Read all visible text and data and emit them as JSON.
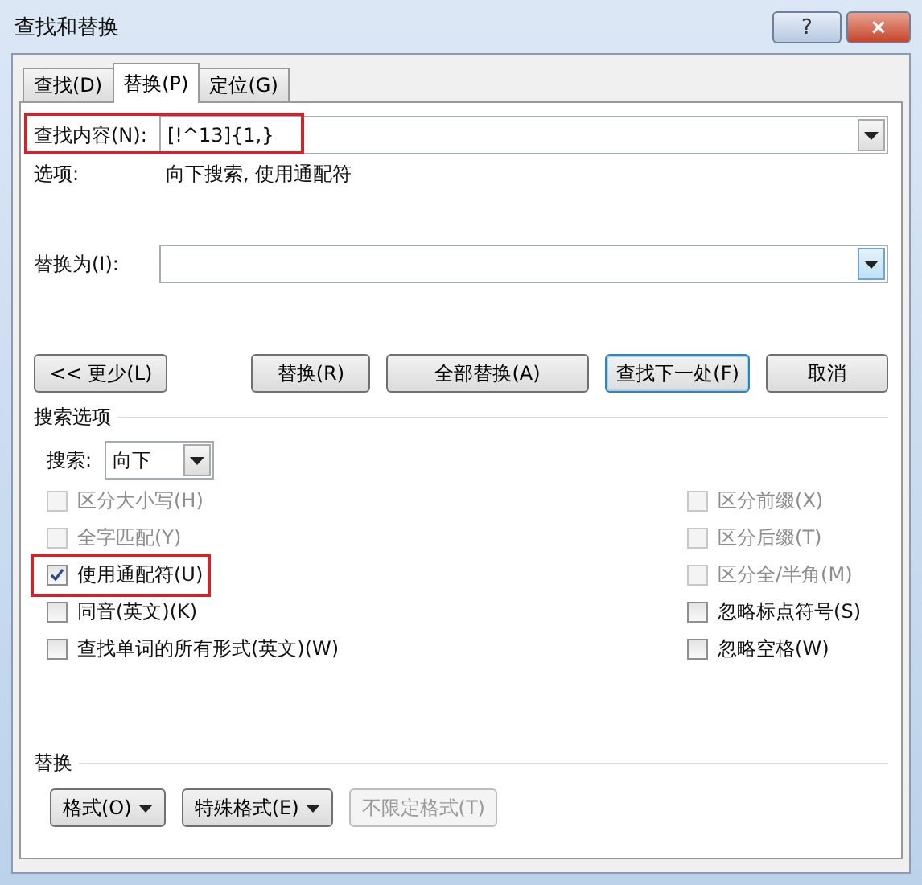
{
  "window": {
    "title": "查找和替换",
    "help": "?",
    "close": "×"
  },
  "tabs": [
    {
      "label": "查找(D)",
      "selected": false
    },
    {
      "label": "替换(P)",
      "selected": true
    },
    {
      "label": "定位(G)",
      "selected": false
    }
  ],
  "find": {
    "label": "查找内容(N):",
    "value": "[!^13]{1,}",
    "highlighted": true
  },
  "options": {
    "label": "选项:",
    "value": "向下搜索, 使用通配符"
  },
  "replace": {
    "label": "替换为(I):"
  },
  "buttons": [
    {
      "label": "<< 更少(L)",
      "default": false
    },
    {
      "label": "替换(R)",
      "default": false
    },
    {
      "label": "全部替换(A)",
      "default": false
    },
    {
      "label": "查找下一处(F)",
      "default": true
    },
    {
      "label": "取消",
      "default": false
    }
  ],
  "search_options": {
    "title": "搜索选项",
    "direction_label": "搜索:",
    "direction": "向下",
    "left": [
      {
        "label": "区分大小写(H)",
        "checked": false,
        "disabled": true,
        "highlighted": false
      },
      {
        "label": "全字匹配(Y)",
        "checked": false,
        "disabled": true,
        "highlighted": false
      },
      {
        "label": "使用通配符(U)",
        "checked": true,
        "disabled": false,
        "highlighted": true
      },
      {
        "label": "同音(英文)(K)",
        "checked": false,
        "disabled": false,
        "highlighted": false
      },
      {
        "label": "查找单词的所有形式(英文)(W)",
        "checked": false,
        "disabled": false,
        "highlighted": false
      }
    ],
    "right": [
      {
        "label": "区分前缀(X)",
        "checked": false,
        "disabled": true,
        "highlighted": false
      },
      {
        "label": "区分后缀(T)",
        "checked": false,
        "disabled": true,
        "highlighted": false
      },
      {
        "label": "区分全/半角(M)",
        "checked": false,
        "disabled": true,
        "highlighted": false
      },
      {
        "label": "忽略标点符号(S)",
        "checked": false,
        "disabled": false,
        "highlighted": false
      },
      {
        "label": "忽略空格(W)",
        "checked": false,
        "disabled": false,
        "highlighted": false
      }
    ]
  },
  "replace_group": {
    "title": "替换",
    "buttons": [
      {
        "label": "格式(O)",
        "dropdown": true,
        "disabled": false
      },
      {
        "label": "特殊格式(E)",
        "dropdown": true,
        "disabled": false
      },
      {
        "label": "不限定格式(T)",
        "dropdown": false,
        "disabled": true
      }
    ]
  }
}
